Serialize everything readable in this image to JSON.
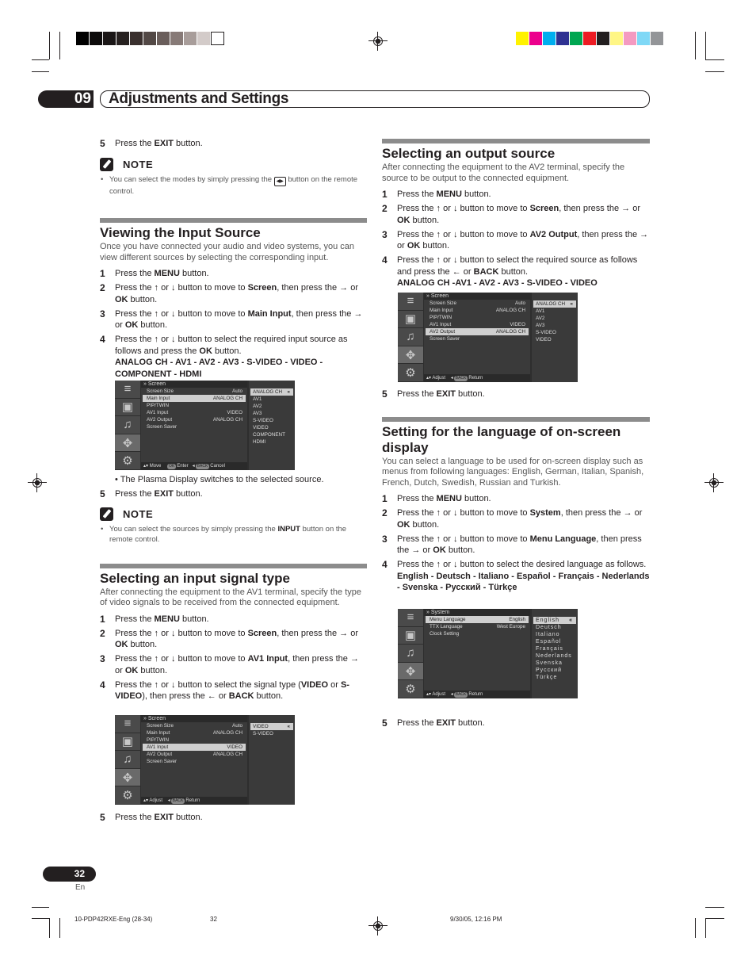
{
  "header": {
    "chapter_number": "09",
    "chapter_title": "Adjustments and Settings"
  },
  "colors": {
    "grayscale_swatches": [
      "#000000",
      "#0d0b0b",
      "#1a1616",
      "#272120",
      "#3a302e",
      "#524845",
      "#6a5e5b",
      "#877a77",
      "#a89d9a",
      "#d3cbc9",
      "#ffffff"
    ],
    "color_swatches": [
      "#fff200",
      "#ec008c",
      "#00aeef",
      "#2e3192",
      "#00a651",
      "#ed1c24",
      "#231f20",
      "#fff685",
      "#f49ac1",
      "#7fd8f6",
      "#939598"
    ],
    "section_bar": "#8c8c8c",
    "text": "#231f20"
  },
  "left": {
    "top_step": {
      "num": "5",
      "pre": "Press the ",
      "bold": "EXIT",
      "post": " button."
    },
    "note1": {
      "label": "NOTE",
      "pre": "You can select the modes by simply pressing the ",
      "icon": "screen-mode-button-icon",
      "post": " button on the remote control."
    },
    "viewing": {
      "title": "Viewing the Input Source",
      "intro": "Once you have connected your audio and video systems, you can view different sources by selecting the corresponding input.",
      "steps": [
        {
          "num": "1",
          "parts": [
            "Press the ",
            "MENU",
            " button."
          ]
        },
        {
          "num": "2",
          "parts": [
            "Press the ",
            "↑",
            " or ",
            "↓",
            " button to move to ",
            "Screen",
            ", then press the ",
            "→",
            " or ",
            "OK",
            " button."
          ]
        },
        {
          "num": "3",
          "parts": [
            "Press the ",
            "↑",
            " or ",
            "↓",
            " button to move to ",
            "Main Input",
            ", then press the ",
            "→",
            " or ",
            "OK",
            " button."
          ]
        },
        {
          "num": "4",
          "parts": [
            "Press the ",
            "↑",
            " or ",
            "↓",
            " button to select the required input source as follows and press the ",
            "OK",
            " button."
          ]
        }
      ],
      "sequence": "ANALOG CH - AV1 - AV2 - AV3 - S-VIDEO - VIDEO - COMPONENT - HDMI",
      "osd": {
        "header": "Screen",
        "rows": [
          {
            "label": "Screen Size",
            "value": "Auto"
          },
          {
            "label": "Main Input",
            "value": "ANALOG CH",
            "highlighted": true
          },
          {
            "label": "PIP/TWIN",
            "value": ""
          },
          {
            "label": "AV1 Input",
            "value": "VIDEO"
          },
          {
            "label": "AV2 Output",
            "value": "ANALOG CH"
          },
          {
            "label": "Screen Saver",
            "value": ""
          }
        ],
        "options": [
          "ANALOG CH",
          "AV1",
          "AV2",
          "AV3",
          "S-VIDEO",
          "VIDEO",
          "COMPONENT",
          "HDMI"
        ],
        "selected_option": "ANALOG CH",
        "footer": {
          "move": "Move",
          "ok_key": "OK",
          "enter": "Enter",
          "back_key": "BACK",
          "cancel": "Cancel"
        }
      },
      "bullet": "The Plasma Display switches to the selected source.",
      "step5": {
        "num": "5",
        "pre": "Press the ",
        "bold": "EXIT",
        "post": " button."
      },
      "note": {
        "label": "NOTE",
        "pre": "You can select the sources by simply pressing the ",
        "bold": "INPUT",
        "post": " button on the remote control."
      }
    },
    "signal": {
      "title": "Selecting an input signal type",
      "intro": "After connecting the equipment to the AV1 terminal, specify the type of video signals to be received from the connected equipment.",
      "steps": [
        {
          "num": "1",
          "parts": [
            "Press the ",
            "MENU",
            " button."
          ]
        },
        {
          "num": "2",
          "parts": [
            "Press the ",
            "↑",
            " or ",
            "↓",
            " button to move to ",
            "Screen",
            ", then press the ",
            "→",
            " or ",
            "OK",
            " button."
          ]
        },
        {
          "num": "3",
          "parts": [
            "Press the ",
            "↑",
            " or ",
            "↓",
            " button to move to ",
            "AV1 Input",
            ", then press the ",
            "→",
            " or ",
            "OK",
            " button."
          ]
        },
        {
          "num": "4",
          "parts": [
            "Press the ",
            "↑",
            " or ",
            "↓",
            " button to select the signal type (",
            "VIDEO",
            " or ",
            "S-VIDEO",
            "), then press the ",
            "←",
            " or ",
            "BACK",
            " button."
          ]
        }
      ],
      "osd": {
        "header": "Screen",
        "rows": [
          {
            "label": "Screen Size",
            "value": "Auto"
          },
          {
            "label": "Main Input",
            "value": "ANALOG CH"
          },
          {
            "label": "PIP/TWIN",
            "value": ""
          },
          {
            "label": "AV1 Input",
            "value": "VIDEO",
            "highlighted": true
          },
          {
            "label": "AV2 Output",
            "value": "ANALOG CH"
          },
          {
            "label": "Screen Saver",
            "value": ""
          }
        ],
        "options": [
          "VIDEO",
          "S-VIDEO"
        ],
        "selected_option": "VIDEO",
        "footer": {
          "adjust": "Adjust",
          "back_key": "BACK",
          "return": "Return"
        }
      },
      "step5": {
        "num": "5",
        "pre": "Press the ",
        "bold": "EXIT",
        "post": " button."
      }
    }
  },
  "right": {
    "output": {
      "title": "Selecting an output source",
      "intro": "After connecting the equipment to the AV2 terminal, specify the source to be output to the connected equipment.",
      "steps": [
        {
          "num": "1",
          "parts": [
            "Press the ",
            "MENU",
            " button."
          ]
        },
        {
          "num": "2",
          "parts": [
            "Press the ",
            "↑",
            " or ",
            "↓",
            " button to move to ",
            "Screen",
            ", then press the ",
            "→",
            " or ",
            "OK",
            " button."
          ]
        },
        {
          "num": "3",
          "parts": [
            "Press the ",
            "↑",
            " or ",
            "↓",
            " button to move to ",
            "AV2 Output",
            ", then press the ",
            "→",
            " or ",
            "OK",
            " button."
          ]
        },
        {
          "num": "4",
          "parts": [
            "Press the ",
            "↑",
            " or ",
            "↓",
            " button to select the required source as follows and press the ",
            "←",
            " or ",
            "BACK",
            " button."
          ]
        }
      ],
      "sequence": "ANALOG CH -AV1 - AV2 - AV3 - S-VIDEO - VIDEO",
      "osd": {
        "header": "Screen",
        "rows": [
          {
            "label": "Screen Size",
            "value": "Auto"
          },
          {
            "label": "Main Input",
            "value": "ANALOG CH"
          },
          {
            "label": "PIP/TWIN",
            "value": ""
          },
          {
            "label": "AV1 Input",
            "value": "VIDEO"
          },
          {
            "label": "AV2 Output",
            "value": "ANALOG CH",
            "highlighted": true
          },
          {
            "label": "Screen Saver",
            "value": ""
          }
        ],
        "options": [
          "ANALOG CH",
          "AV1",
          "AV2",
          "AV3",
          "S-VIDEO",
          "VIDEO"
        ],
        "selected_option": "ANALOG CH",
        "footer": {
          "adjust": "Adjust",
          "back_key": "BACK",
          "return": "Return"
        }
      },
      "step5": {
        "num": "5",
        "pre": "Press the ",
        "bold": "EXIT",
        "post": " button."
      }
    },
    "language": {
      "title": "Setting for the language of on-screen display",
      "intro": "You can select a language to be used for on-screen display such as menus from following languages: English, German, Italian, Spanish, French, Dutch, Swedish, Russian and Turkish.",
      "steps": [
        {
          "num": "1",
          "parts": [
            "Press the ",
            "MENU",
            " button."
          ]
        },
        {
          "num": "2",
          "parts": [
            "Press the ",
            "↑",
            " or ",
            "↓",
            " button to move to ",
            "System",
            ", then press the ",
            "→",
            " or ",
            "OK",
            " button."
          ]
        },
        {
          "num": "3",
          "parts": [
            "Press the ",
            "↑",
            " or ",
            "↓",
            " button to move to ",
            "Menu Language",
            ", then press the ",
            "→",
            " or ",
            "OK",
            " button."
          ]
        },
        {
          "num": "4",
          "parts": [
            "Press the ",
            "↑",
            " or ",
            "↓",
            " button to select the desired language as follows."
          ]
        }
      ],
      "sequence": "English - Deutsch - Italiano - Español - Français - Nederlands - Svenska - Русский - Türkçe",
      "osd": {
        "header": "System",
        "rows": [
          {
            "label": "Menu Language",
            "value": "English",
            "highlighted": true
          },
          {
            "label": "TTX Language",
            "value": "West Europe"
          },
          {
            "label": "Clock Setting",
            "value": ""
          }
        ],
        "options": [
          "English",
          "Deutsch",
          "Italiano",
          "Español",
          "Français",
          "Nederlands",
          "Svenska",
          "Русский",
          "Türkçe"
        ],
        "selected_option": "English",
        "footer": {
          "adjust": "Adjust",
          "back_key": "BACK",
          "return": "Return"
        }
      },
      "step5": {
        "num": "5",
        "pre": "Press the ",
        "bold": "EXIT",
        "post": " button."
      }
    }
  },
  "footer": {
    "page_number": "32",
    "language_code": "En",
    "print_file": "10-PDP42RXE-Eng (28-34)",
    "print_page": "32",
    "print_date": "9/30/05, 12:16 PM"
  }
}
